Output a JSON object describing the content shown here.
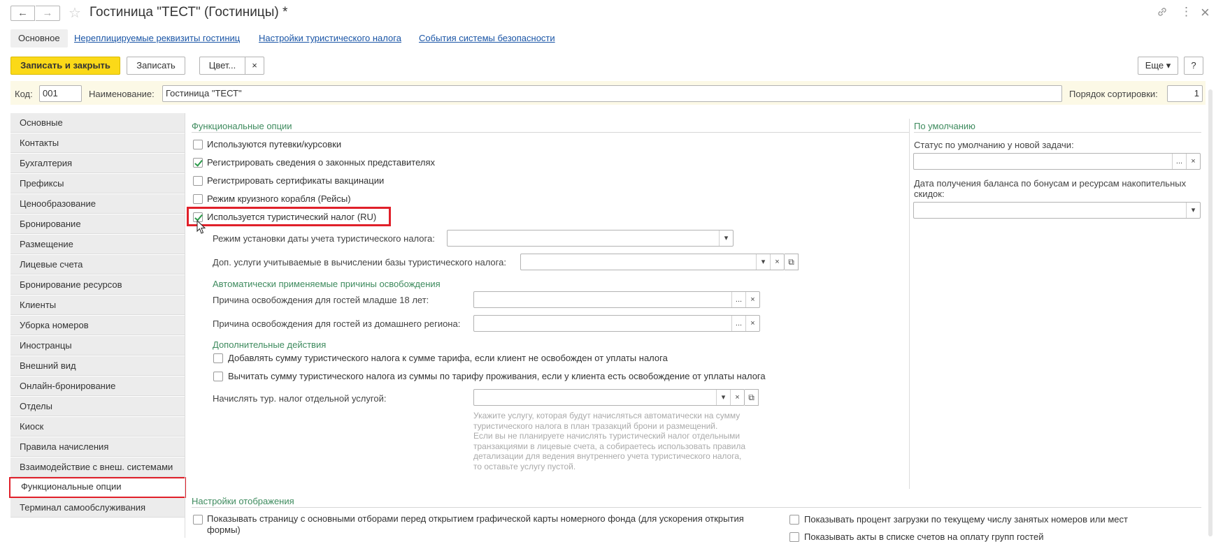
{
  "window": {
    "title": "Гостиница \"ТЕСТ\" (Гостиницы) *",
    "back_icon": "←",
    "forward_icon": "→",
    "star_icon": "☆",
    "link_icon": "🔗",
    "more_icon": "⋮",
    "close_icon": "×"
  },
  "section_tabs": [
    {
      "label": "Основное"
    },
    {
      "label": "Нереплицируемые реквизиты гостиниц"
    },
    {
      "label": "Настройки туристического налога"
    },
    {
      "label": "События системы безопасности"
    }
  ],
  "toolbar": {
    "save_close": "Записать и закрыть",
    "save": "Записать",
    "color": "Цвет...",
    "color_clear": "×",
    "more": "Еще ▾",
    "help": "?"
  },
  "header": {
    "code_label": "Код:",
    "code_value": "001",
    "name_label": "Наименование:",
    "name_value": "Гостиница \"ТЕСТ\"",
    "sort_label": "Порядок сортировки:",
    "sort_value": "1"
  },
  "nav": [
    "Основные",
    "Контакты",
    "Бухгалтерия",
    "Префиксы",
    "Ценообразование",
    "Бронирование",
    "Размещение",
    "Лицевые счета",
    "Бронирование ресурсов",
    "Клиенты",
    "Уборка номеров",
    "Иностранцы",
    "Внешний вид",
    "Онлайн-бронирование",
    "Отделы",
    "Киоск",
    "Правила начисления",
    "Взаимодействие с внеш. системами",
    "Функциональные опции",
    "Терминал самообслуживания"
  ],
  "functional": {
    "title": "Функциональные опции",
    "options": [
      {
        "label": "Используются путевки/курсовки",
        "checked": false
      },
      {
        "label": "Регистрировать сведения о законных представителях",
        "checked": true
      },
      {
        "label": "Регистрировать сертификаты вакцинации",
        "checked": false
      },
      {
        "label": "Режим круизного корабля (Рейсы)",
        "checked": false
      },
      {
        "label": "Используется туристический налог (RU)",
        "checked": true
      }
    ],
    "tax_date_mode_label": "Режим установки даты учета туристического налога:",
    "extra_services_label": "Доп. услуги учитываемые в вычислении базы туристического налога:",
    "exemptions_title": "Автоматически применяемые причины освобождения",
    "under18_label": "Причина освобождения для гостей младше 18 лет:",
    "home_region_label": "Причина освобождения для гостей из домашнего региона:",
    "extra_actions_title": "Дополнительные действия",
    "add_to_tariff": "Добавлять сумму туристического налога к сумме тарифа, если клиент не освобожден от уплаты налога",
    "subtract_from_tariff": "Вычитать сумму туристического налога из суммы по тарифу проживания, если у клиента есть освобождение от уплаты налога",
    "separate_service_label": "Начислять тур. налог отдельной услугой:",
    "hint": "Укажите услугу, которая будут начисляться автоматически на сумму туристического налога в план тразакций брони и размещений.\nЕсли вы не планируете начислять туристический налог отдельными транзакциями в лицевые счета, а собираетесь использовать правила детализации для ведения внутреннего учета туристического налога, то оставьте услугу пустой."
  },
  "defaults": {
    "title": "По умолчанию",
    "task_status_label": "Статус по умолчанию у новой задачи:",
    "bonus_balance_label": "Дата получения баланса по бонусам и ресурсам накопительных скидок:"
  },
  "display": {
    "title": "Настройки отображения",
    "show_filters_page": "Показывать страницу с основными отборами перед открытием графической карты номерного фонда (для ускорения открытия формы)",
    "show_load_percent": "Показывать процент загрузки по текущему числу занятых номеров или мест",
    "show_acts": "Показывать акты в списке счетов на оплату групп гостей"
  },
  "buttons": {
    "dots": "...",
    "clear": "×",
    "dropdown": "▾",
    "open": "⧉"
  },
  "colors": {
    "accent_yellow": "#fbd918",
    "group_green": "#3e8b5e",
    "highlight_red": "#e0202a",
    "link_blue": "#1a55a6"
  }
}
